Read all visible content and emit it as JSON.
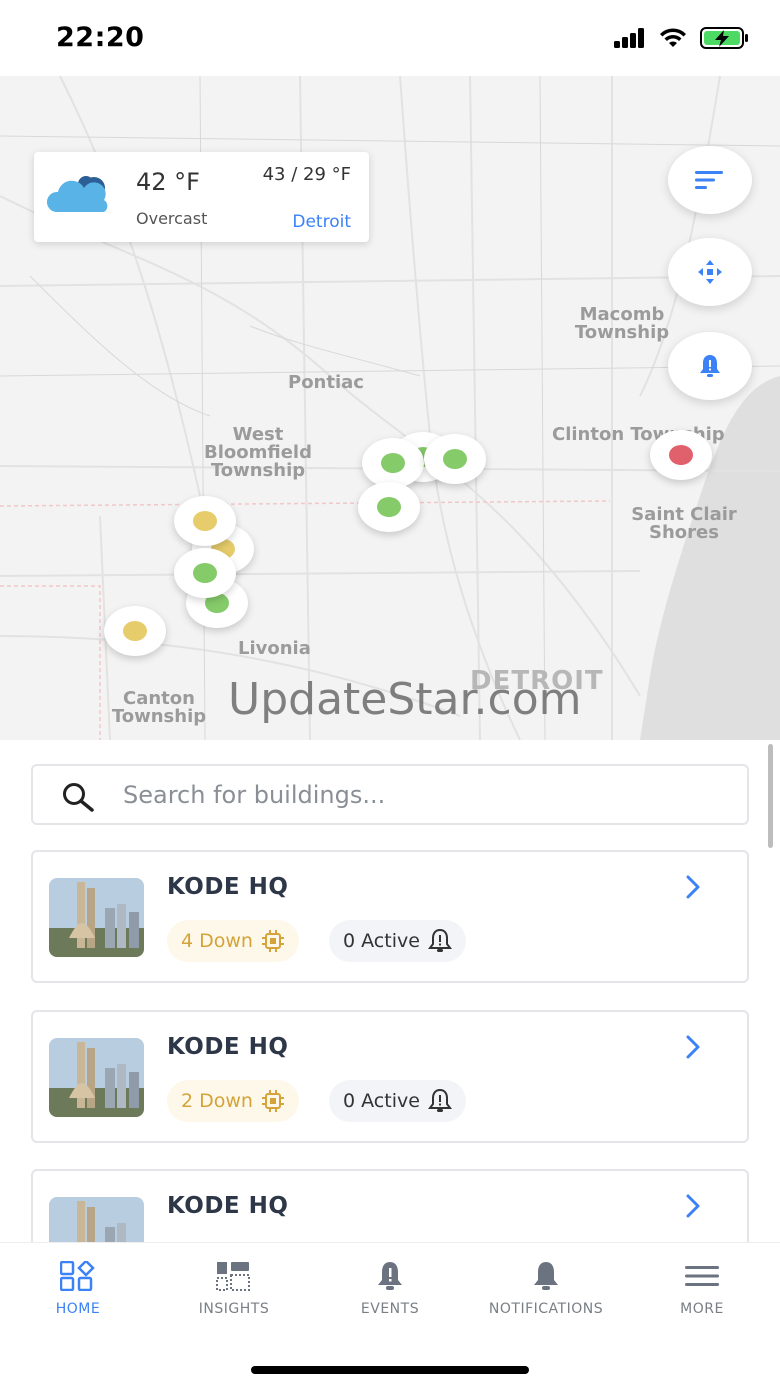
{
  "status_bar": {
    "time": "22:20"
  },
  "weather": {
    "temperature": "42 °F",
    "condition": "Overcast",
    "range": "43 / 29 °F",
    "city": "Detroit"
  },
  "map": {
    "labels": {
      "pontiac": "Pontiac",
      "west_bloomfield": "West Bloomfield Township",
      "macomb": "Macomb Township",
      "clinton": "Clinton Township",
      "saint_clair": "Saint Clair Shores",
      "livonia": "Livonia",
      "canton": "Canton Township",
      "detroit": "DETROIT"
    },
    "watermark": "UpdateStar.com",
    "marker_colors": {
      "green": "#86cb6a",
      "yellow": "#e6cc6a",
      "red": "#e0616c"
    }
  },
  "search": {
    "placeholder": "Search for buildings..."
  },
  "buildings": [
    {
      "name": "KODE HQ",
      "down": "4 Down",
      "active": "0 Active"
    },
    {
      "name": "KODE HQ",
      "down": "2 Down",
      "active": "0 Active"
    },
    {
      "name": "KODE HQ",
      "down": "",
      "active": ""
    }
  ],
  "nav": {
    "home": "HOME",
    "insights": "INSIGHTS",
    "events": "EVENTS",
    "notifications": "NOTIFICATIONS",
    "more": "MORE"
  },
  "colors": {
    "accent": "#3b82f6",
    "warning": "#d4a43a"
  }
}
